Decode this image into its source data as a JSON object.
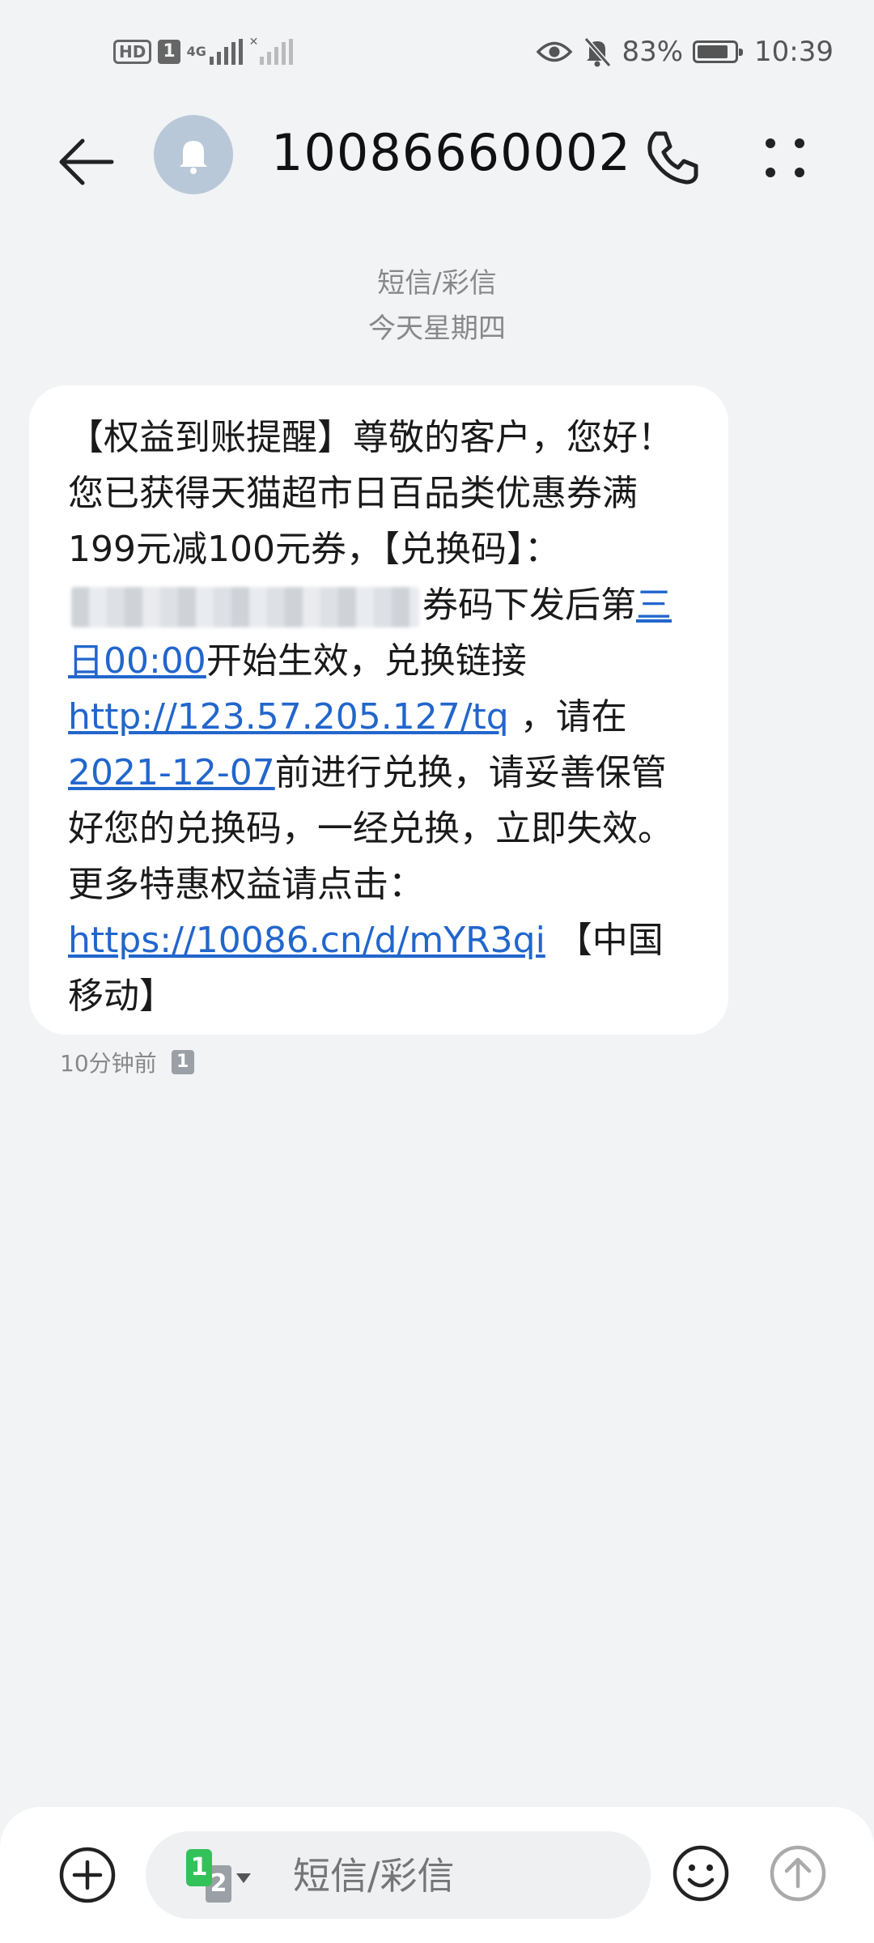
{
  "status_bar": {
    "hd": "HD",
    "sim": "1",
    "network": "4G",
    "battery": "83%",
    "battery_level": 0.83,
    "time": "10:39"
  },
  "header": {
    "title": "10086660002",
    "icons": [
      "back-arrow-icon",
      "bell-icon",
      "phone-icon",
      "more-icon"
    ]
  },
  "meta": {
    "type": "短信/彩信",
    "day": "今天星期四"
  },
  "message": {
    "p1": "【权益到账提醒】尊敬的客户，您好！您已获得天猫超市日百品类优惠券满199元减100元券，【兑换码】：",
    "p2": "券码下发后第",
    "date_link": "三日00:00",
    "p3": "开始生效，兑换链接 ",
    "url1": "http://123.57.205.127/tq",
    "p4": " ，请在",
    "date2": "2021-12-07",
    "p5": "前进行兑换，请妥善保管好您的兑换码，一经兑换，立即失效。更多特惠权益请点击：",
    "url2": "https://10086.cn/d/mYR3qi",
    "p6": " 【中国移动】",
    "time_ago": "10分钟前",
    "sim_slot": "1"
  },
  "composer": {
    "placeholder": "短信/彩信",
    "sim_primary": "1",
    "sim_secondary": "2"
  },
  "colors": {
    "background": "#f1f3f5",
    "link": "#2266cc",
    "sim1": "#33c15a"
  }
}
